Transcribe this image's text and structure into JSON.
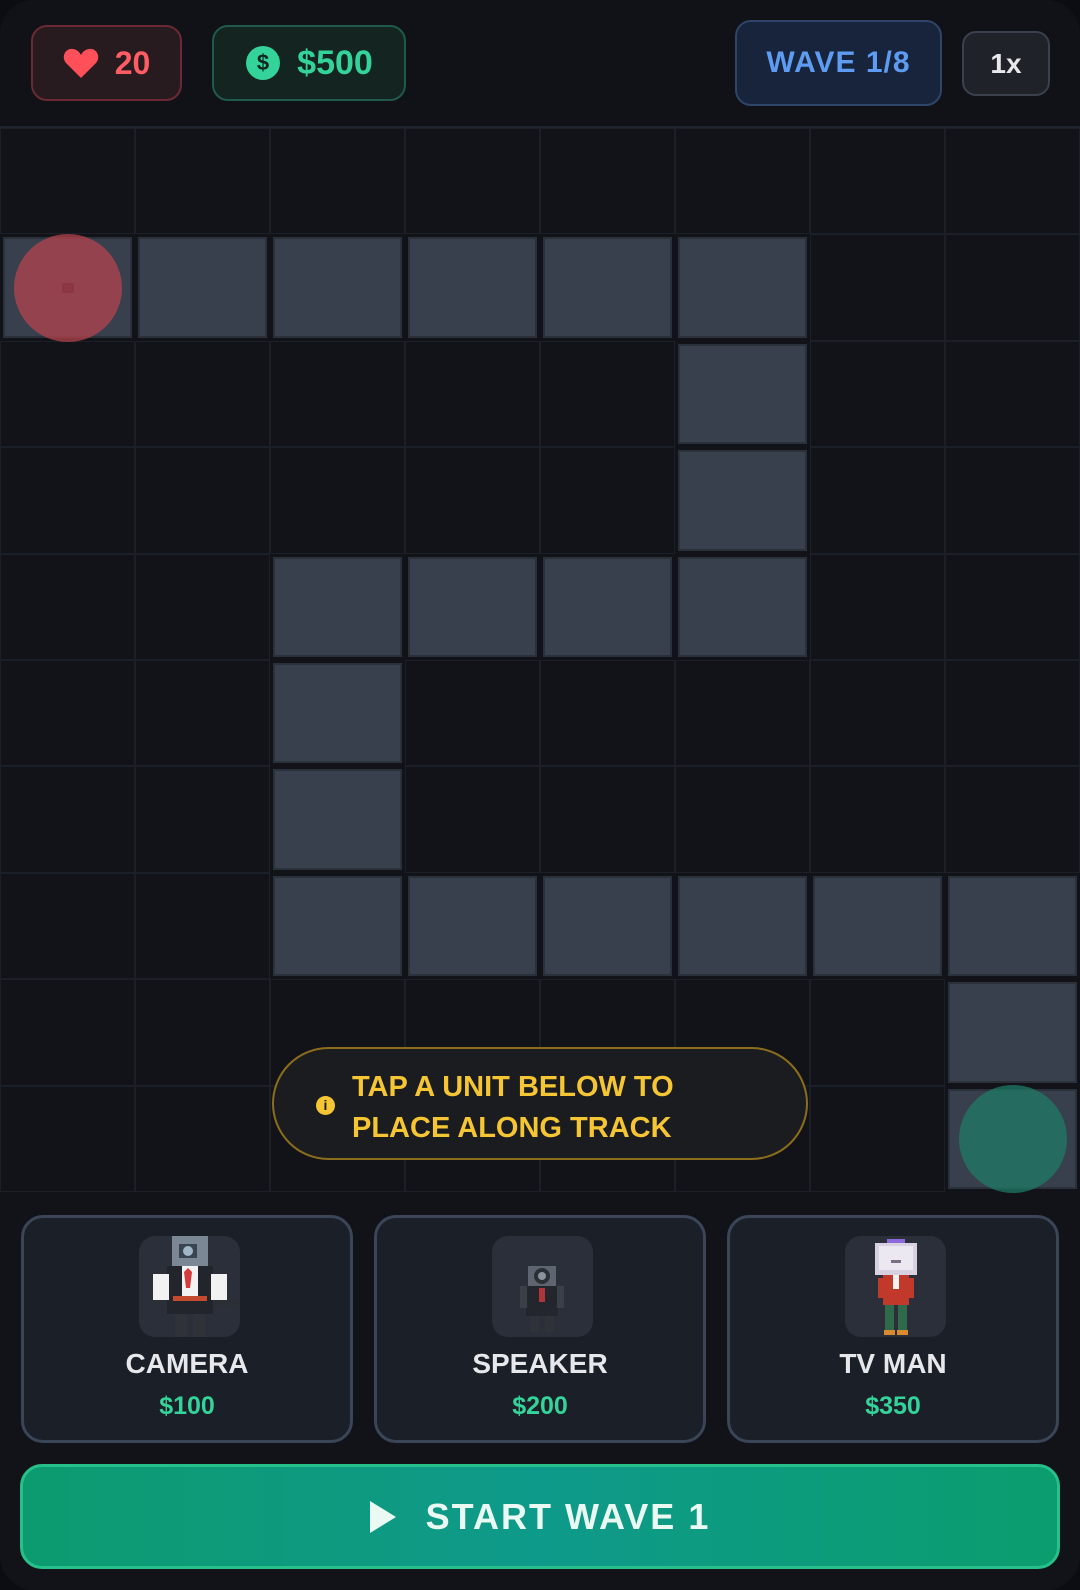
{
  "hud": {
    "lives": "20",
    "money": "$500",
    "wave": "WAVE 1/8",
    "speed": "1x"
  },
  "board": {
    "cols": 8,
    "rows": 10,
    "path_cells": [
      [
        1,
        0
      ],
      [
        1,
        1
      ],
      [
        1,
        2
      ],
      [
        1,
        3
      ],
      [
        1,
        4
      ],
      [
        1,
        5
      ],
      [
        2,
        5
      ],
      [
        3,
        5
      ],
      [
        4,
        5
      ],
      [
        4,
        4
      ],
      [
        4,
        3
      ],
      [
        4,
        2
      ],
      [
        5,
        2
      ],
      [
        6,
        2
      ],
      [
        7,
        2
      ],
      [
        7,
        3
      ],
      [
        7,
        4
      ],
      [
        7,
        5
      ],
      [
        7,
        6
      ],
      [
        7,
        7
      ],
      [
        8,
        7
      ],
      [
        9,
        7
      ]
    ],
    "spawn_cell": [
      1,
      0
    ],
    "goal_cell": [
      9,
      7
    ]
  },
  "hint": {
    "line1": "TAP A UNIT BELOW TO",
    "line2": "PLACE ALONG TRACK"
  },
  "shop": {
    "units": [
      {
        "name": "CAMERA",
        "price": "$100"
      },
      {
        "name": "SPEAKER",
        "price": "$200"
      },
      {
        "name": "TV MAN",
        "price": "$350"
      }
    ]
  },
  "start_button": "START WAVE 1",
  "colors": {
    "lives": "#ff5c64",
    "money": "#34d399",
    "wave": "#5d9cf2",
    "hint": "#f5c533",
    "start": "#0c9b6f"
  }
}
